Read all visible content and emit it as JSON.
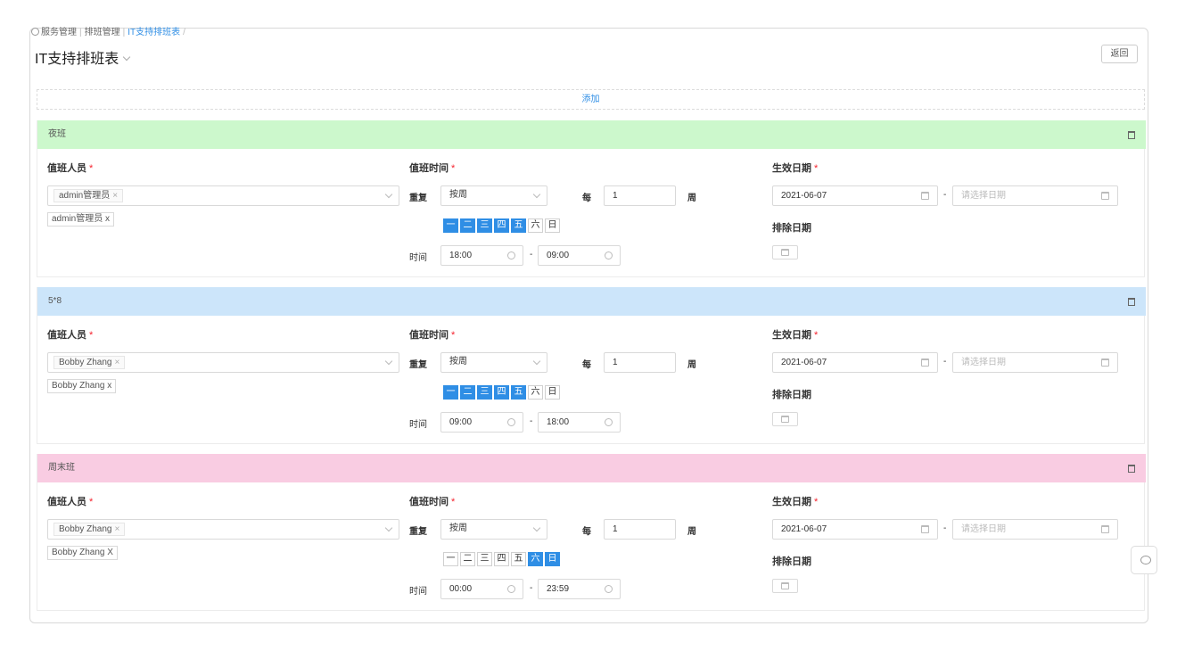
{
  "breadcrumb": {
    "item1": "服务管理",
    "item2": "排班管理",
    "item3": "IT支持排班表",
    "sep": "|",
    "trail": "/"
  },
  "page": {
    "title": "IT支持排班表",
    "back_label": "返回",
    "add_label": "添加"
  },
  "labels": {
    "staff": "值班人员",
    "time": "值班时间",
    "effective": "生效日期",
    "repeat": "重复",
    "every": "每",
    "week_unit": "周",
    "exclude": "排除日期",
    "time_label": "时间",
    "required": "*",
    "date_placeholder": "请选择日期",
    "dash": "-",
    "tag_close": "×"
  },
  "weekdays": [
    "一",
    "二",
    "三",
    "四",
    "五",
    "六",
    "日"
  ],
  "colors": {
    "accent": "#2f8ee5",
    "night": "#ccf8cc",
    "weekday": "#cce5fa",
    "weekend": "#f9cce2"
  },
  "shifts": [
    {
      "name": "夜班",
      "color": "#ccf8cc",
      "staff_tag": "admin管理员",
      "staff_chip": "admin管理员 x",
      "repeat_mode": "按周",
      "every_count": "1",
      "days_on": [
        true,
        true,
        true,
        true,
        true,
        false,
        false
      ],
      "start_time": "18:00",
      "end_time": "09:00",
      "start_date": "2021-06-07"
    },
    {
      "name": "5*8",
      "color": "#cce5fa",
      "staff_tag": "Bobby Zhang",
      "staff_chip": "Bobby Zhang x",
      "repeat_mode": "按周",
      "every_count": "1",
      "days_on": [
        true,
        true,
        true,
        true,
        true,
        false,
        false
      ],
      "start_time": "09:00",
      "end_time": "18:00",
      "start_date": "2021-06-07"
    },
    {
      "name": "周末班",
      "color": "#f9cce2",
      "staff_tag": "Bobby Zhang",
      "staff_chip": "Bobby Zhang X",
      "repeat_mode": "按周",
      "every_count": "1",
      "days_on": [
        false,
        false,
        false,
        false,
        false,
        true,
        true
      ],
      "start_time": "00:00",
      "end_time": "23:59",
      "start_date": "2021-06-07"
    }
  ]
}
